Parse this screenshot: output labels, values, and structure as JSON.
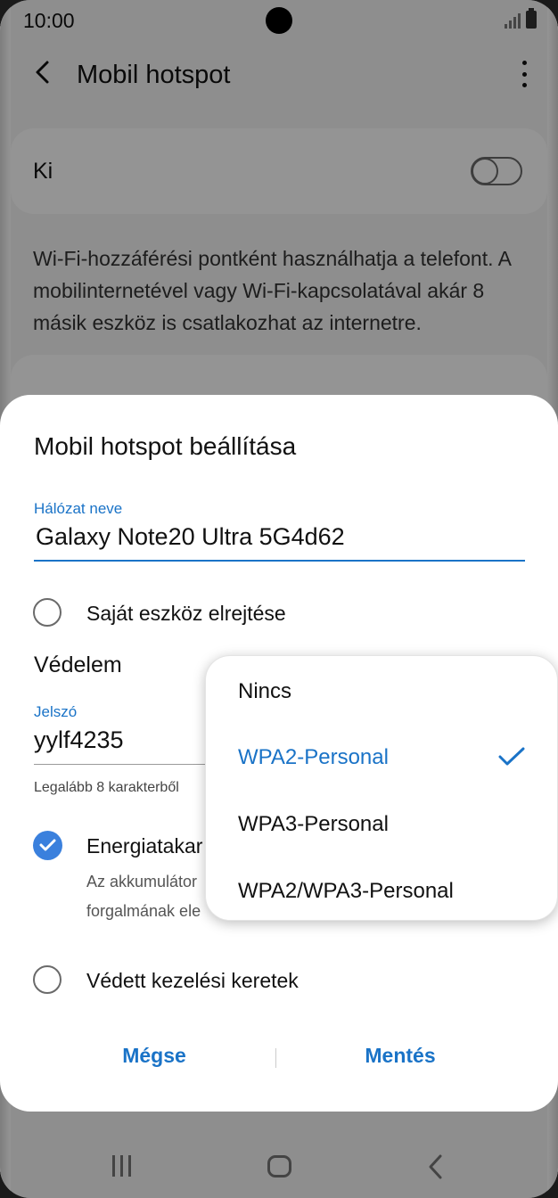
{
  "status_bar": {
    "time": "10:00"
  },
  "app_bar": {
    "title": "Mobil hotspot"
  },
  "hotspot_toggle": {
    "label": "Ki",
    "state": "off"
  },
  "description": "Wi-Fi-hozzáférési pontként használhatja a telefont. A mobilinternetével vagy Wi-Fi-kapcsolatával akár 8 másik eszköz is csatlakozhat az internetre.",
  "dialog": {
    "title": "Mobil hotspot beállítása",
    "network_name_label": "Hálózat neve",
    "network_name_value": "Galaxy Note20 Ultra 5G4d62",
    "hide_device_label": "Saját eszköz elrejtése",
    "hide_device_checked": false,
    "security_label": "Védelem",
    "password_label": "Jelszó",
    "password_value": "yylf4235",
    "password_hint": "Legalább 8 karakterből",
    "power_saving_title": "Energiatakar",
    "power_saving_desc": "Az akkumulátor forgalmának ele",
    "power_saving_checked": true,
    "pmf_label": "Védett kezelési keretek",
    "pmf_checked": false,
    "cancel_label": "Mégse",
    "save_label": "Mentés"
  },
  "security_dropdown": {
    "options": [
      "Nincs",
      "WPA2-Personal",
      "WPA3-Personal",
      "WPA2/WPA3-Personal"
    ],
    "selected": "WPA2-Personal"
  },
  "colors": {
    "accent": "#1a73c7",
    "checkbox": "#3a80dd"
  }
}
